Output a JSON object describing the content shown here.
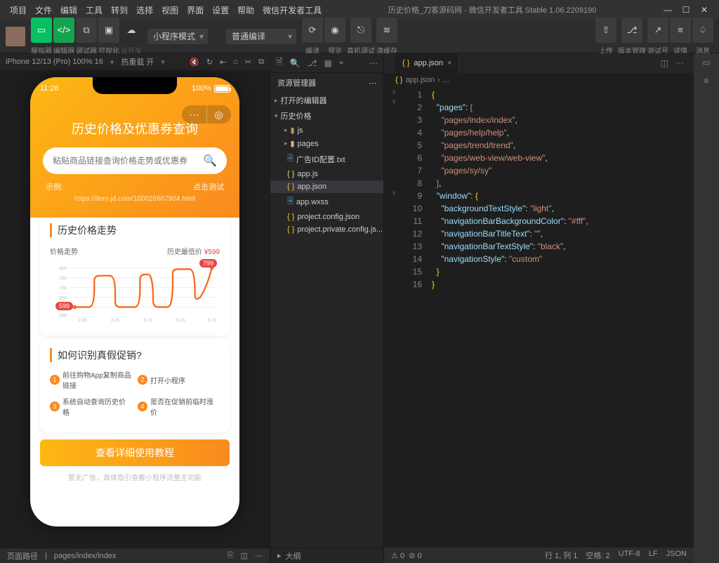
{
  "titlebar": {
    "menus": [
      "项目",
      "文件",
      "编辑",
      "工具",
      "转到",
      "选择",
      "视图",
      "界面",
      "设置",
      "帮助",
      "微信开发者工具"
    ],
    "title": "历史价格_刀客源码网 - 微信开发者工具 Stable 1.06.2209190"
  },
  "toolbar": {
    "labels": {
      "simulator": "模拟器",
      "editor": "编辑器",
      "debugger": "调试器",
      "visualizer": "可视化",
      "cloud": "云开发"
    },
    "mode_dropdown": "小程序模式",
    "compile_dropdown": "普通编译",
    "actions": {
      "compile": "编译",
      "preview": "预览",
      "remote": "真机调试",
      "cache": "清缓存",
      "upload": "上传",
      "version": "版本管理",
      "testacct": "测试号",
      "details": "详情",
      "notify": "消息"
    }
  },
  "sim_bar": {
    "device": "iPhone 12/13 (Pro) 100% 16",
    "reload": "热重载 开"
  },
  "phone": {
    "time": "11:26",
    "signal": "100%",
    "search_title": "历史价格及优惠券查询",
    "search_placeholder": "粘贴商品链接查询价格走势或优惠券",
    "example_label": "示例:",
    "test_label": "点击测试",
    "example_url": "https://item.jd.com/100026667904.html",
    "card1_title": "历史价格走势",
    "chart_legend": "价格走势",
    "chart_low_label": "历史最低价",
    "chart_low_price": "¥599",
    "card2_title": "如何识别真假促销?",
    "steps": [
      "前往购物App复制商品链接",
      "打开小程序",
      "系统自动查询历史价格",
      "是否在促销前临时涨价"
    ],
    "big_button": "查看详细使用教程",
    "ad_note": "暂无广告，具体指引查看小程序流量主功能"
  },
  "chart_data": {
    "type": "line",
    "title": "价格走势",
    "xlabel": "",
    "ylabel": "",
    "categories": [
      "2.15",
      "3.15",
      "4.15",
      "5.15",
      "6.15"
    ],
    "values": [
      599,
      750,
      620,
      760,
      799
    ],
    "ylim": [
      550,
      800
    ],
    "annotations": [
      {
        "x": "2.15",
        "y": 599,
        "label": "599"
      },
      {
        "x": "6.15",
        "y": 799,
        "label": "799"
      }
    ]
  },
  "explorer": {
    "title": "资源管理器",
    "sections": {
      "editors": "打开的编辑器",
      "root": "历史价格"
    },
    "tree": {
      "js": "js",
      "pages": "pages",
      "ad_txt": "广告ID配置.txt",
      "appjs": "app.js",
      "appjson": "app.json",
      "appwxss": "app.wxss",
      "projconf": "project.config.json",
      "projpriv": "project.private.config.js..."
    },
    "outline": "大纲"
  },
  "editor": {
    "tab_name": "app.json",
    "breadcrumb": "app.json",
    "code": {
      "pages": [
        "pages/index/index",
        "pages/help/help",
        "pages/trend/trend",
        "pages/web-view/web-view",
        "pages/sy/sy"
      ],
      "window": {
        "backgroundTextStyle": "light",
        "navigationBarBackgroundColor": "#fff",
        "navigationBarTitleText": "",
        "navigationBarTextStyle": "black",
        "navigationStyle": "custom"
      }
    }
  },
  "bottombar": {
    "path_label": "页面路径",
    "path": "pages/index/index"
  },
  "statusbar": {
    "pos": "行 1, 列 1",
    "spaces": "空格: 2",
    "enc": "UTF-8",
    "eol": "LF",
    "lang": "JSON",
    "warn": "0",
    "err": "0"
  }
}
